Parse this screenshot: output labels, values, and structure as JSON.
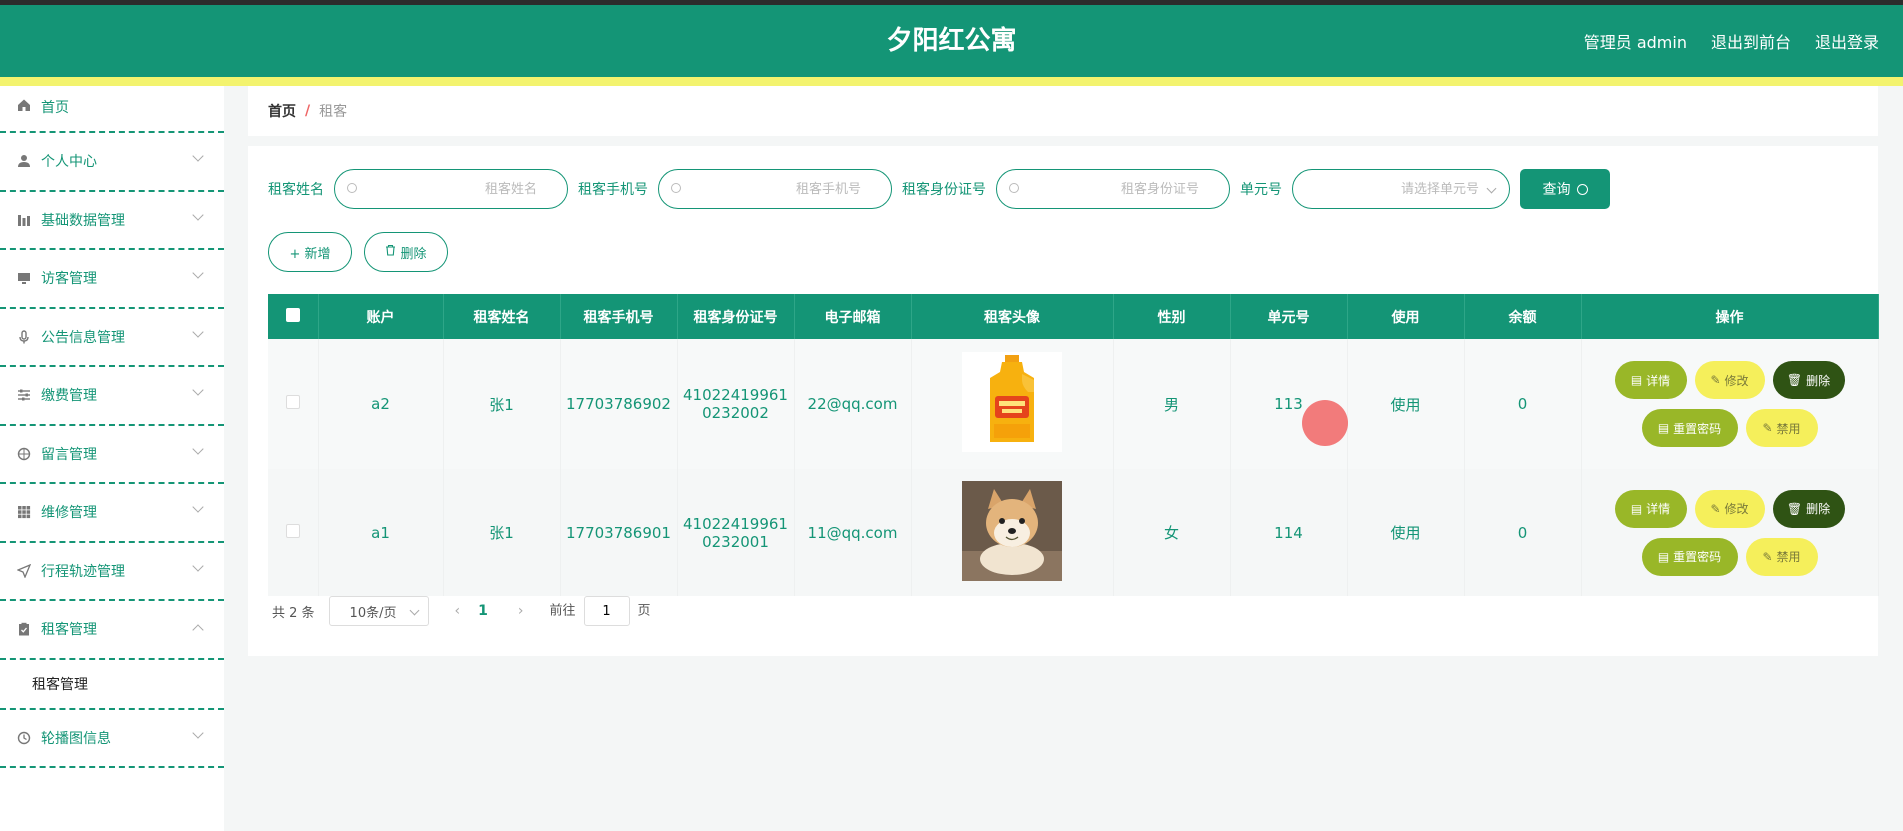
{
  "header": {
    "title": "夕阳红公寓",
    "links": [
      "管理员 admin",
      "退出到前台",
      "退出登录"
    ]
  },
  "sidebar": {
    "items": [
      {
        "label": "首页",
        "icon": "home-icon"
      },
      {
        "label": "个人中心",
        "icon": "user-icon"
      },
      {
        "label": "基础数据管理",
        "icon": "bar-chart-icon"
      },
      {
        "label": "访客管理",
        "icon": "monitor-icon"
      },
      {
        "label": "公告信息管理",
        "icon": "microphone-icon"
      },
      {
        "label": "缴费管理",
        "icon": "sliders-icon"
      },
      {
        "label": "留言管理",
        "icon": "compass-icon"
      },
      {
        "label": "维修管理",
        "icon": "grid-icon"
      },
      {
        "label": "行程轨迹管理",
        "icon": "navigation-icon"
      },
      {
        "label": "租客管理",
        "icon": "clipboard-icon"
      },
      {
        "label": "轮播图信息",
        "icon": "clock-icon"
      }
    ],
    "submenu": "租客管理"
  },
  "breadcrumb": {
    "home": "首页",
    "sep": "/",
    "current": "租客"
  },
  "search": {
    "fields": [
      {
        "label": "租客姓名",
        "placeholder": "租客姓名"
      },
      {
        "label": "租客手机号",
        "placeholder": "租客手机号"
      },
      {
        "label": "租客身份证号",
        "placeholder": "租客身份证号"
      },
      {
        "label": "单元号",
        "placeholder": "请选择单元号"
      }
    ],
    "query_label": "查询"
  },
  "actions": {
    "add_label": "+ 新增",
    "delete_label": "删除"
  },
  "table": {
    "columns": [
      "账户",
      "租客姓名",
      "租客手机号",
      "租客身份证号",
      "电子邮箱",
      "租客头像",
      "性别",
      "单元号",
      "使用",
      "余额",
      "操作"
    ],
    "rows": [
      {
        "account": "a2",
        "name": "张1",
        "phone": "17703786902",
        "id_line1": "41022419961",
        "id_line2": "0232002",
        "email": "22@qq.com",
        "avatar": "oil-bottle-image",
        "gender": "男",
        "unit": "113",
        "use": "使用",
        "balance": "0"
      },
      {
        "account": "a1",
        "name": "张1",
        "phone": "17703786901",
        "id_line1": "41022419961",
        "id_line2": "0232001",
        "email": "11@qq.com",
        "avatar": "dog-image",
        "gender": "女",
        "unit": "114",
        "use": "使用",
        "balance": "0"
      }
    ],
    "ops": {
      "detail": "详情",
      "edit": "修改",
      "delete": "删除",
      "reset": "重置密码",
      "ban": "禁用"
    }
  },
  "pager": {
    "total": "共 2 条",
    "page_size": "10条/页",
    "current_page": "1",
    "goto_prefix": "前往",
    "goto_value": "1",
    "goto_suffix": "页"
  },
  "colors": {
    "primary": "#149576",
    "accent_yellow": "#f3f36e",
    "btn_olive": "#99b728",
    "btn_yellow": "#f5ef5b",
    "btn_dark": "#2f5314"
  }
}
